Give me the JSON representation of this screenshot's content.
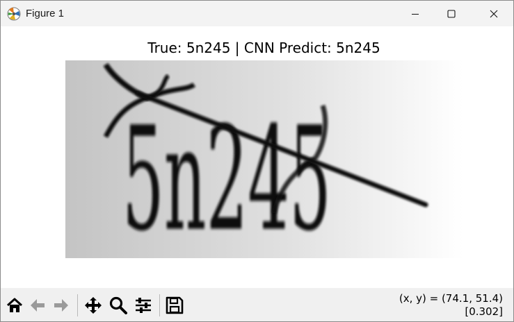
{
  "window": {
    "title": "Figure 1",
    "controls": {
      "minimize": "minimize",
      "maximize": "maximize",
      "close": "close"
    }
  },
  "figure": {
    "title": "True: 5n245 | CNN Predict: 5n245",
    "image_text": "5n245"
  },
  "toolbar": {
    "buttons": [
      "home-icon",
      "back-arrow-icon",
      "forward-arrow-icon",
      "pan-icon",
      "zoom-icon",
      "configure-subplots-icon",
      "save-icon"
    ],
    "coords": "(x, y) = (74.1, 51.4)",
    "value": "[0.302]"
  }
}
